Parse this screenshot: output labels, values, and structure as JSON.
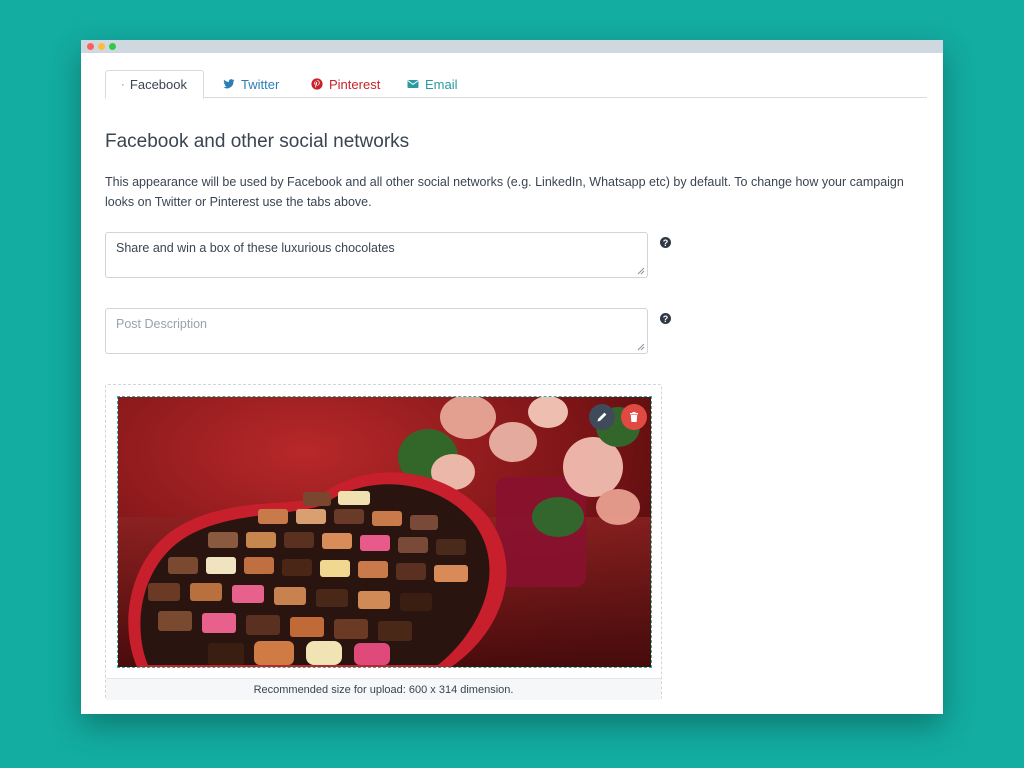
{
  "tabs": [
    {
      "label": "Facebook",
      "icon": "facebook-icon",
      "color": "#3a4552",
      "active": true
    },
    {
      "label": "Twitter",
      "icon": "twitter-icon",
      "color": "#2a7fb8"
    },
    {
      "label": "Pinterest",
      "icon": "pinterest-icon",
      "color": "#c8232c"
    },
    {
      "label": "Email",
      "icon": "email-icon",
      "color": "#2a9aa0"
    }
  ],
  "section": {
    "title": "Facebook and other social networks",
    "description": "This appearance will be used by Facebook and all other social networks (e.g. LinkedIn, Whatsapp etc) by default. To change how your campaign looks on Twitter or Pinterest use the tabs above."
  },
  "post_title": {
    "value": "Share and win a box of these luxurious chocolates"
  },
  "post_description": {
    "placeholder": "Post Description"
  },
  "image_upload": {
    "caption": "Recommended size for upload: 600 x 314 dimension."
  },
  "colors": {
    "background": "#13ada2",
    "edit_button": "#3f4a5a",
    "delete_button": "#e04a42"
  }
}
